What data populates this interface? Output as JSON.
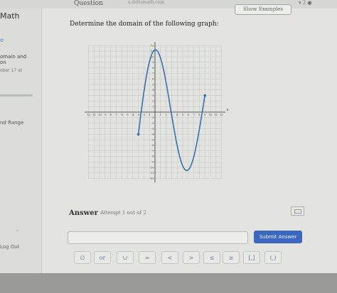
{
  "topbar": {
    "question_label": "Question",
    "url": "a.deltamath.com",
    "show_examples": "Show Examples",
    "status": "▾ 2 ●"
  },
  "sidebar": {
    "title": "Math",
    "item_e": "e",
    "item1_line1": "omain and",
    "item1_line2": "on",
    "item1_date": "ober 17 at",
    "range_item": "nd Range",
    "chevron": "⌄",
    "logout": "Log Out"
  },
  "question": {
    "text": "Determine the domain of the following graph:"
  },
  "graph": {
    "x_ticks": [
      "-12",
      "-11",
      "-10",
      "-9",
      "-8",
      "-7",
      "-6",
      "-5",
      "-4",
      "-3",
      "-2",
      "-1",
      "1",
      "2",
      "3",
      "4",
      "5",
      "6",
      "7",
      "8",
      "9",
      "10",
      "11",
      "12"
    ],
    "y_ticks": [
      "12",
      "11",
      "10",
      "9",
      "8",
      "7",
      "6",
      "5",
      "4",
      "3",
      "2",
      "1",
      "-1",
      "-2",
      "-3",
      "-4",
      "-5",
      "-6",
      "-7",
      "-8",
      "-9",
      "-10",
      "-11",
      "-12"
    ],
    "x_axis_label": "x",
    "curve_color": "#3a6fb0",
    "endpoints": [
      {
        "x": -3,
        "y": -4
      },
      {
        "x": 9,
        "y": 3
      }
    ]
  },
  "answer": {
    "label": "Answer",
    "attempt": "Attempt 1 out of 2",
    "input_value": "",
    "submit_label": "Submit Answer"
  },
  "keypad": [
    "∅",
    "or",
    "∪",
    "∞",
    "<",
    ">",
    "≤",
    "≥",
    "[,]",
    "(,)"
  ]
}
